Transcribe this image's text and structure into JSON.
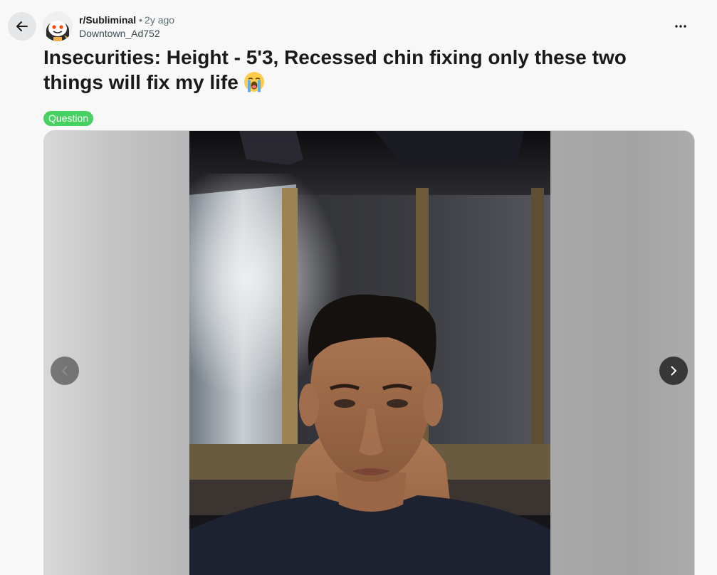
{
  "post": {
    "subreddit": "r/Subliminal",
    "separator": "•",
    "age": "2y ago",
    "author": "Downtown_Ad752",
    "title": "Insecurities: Height - 5'3, Recessed chin fixing only these two things will fix my life",
    "title_emoji": "loudly-crying-face-emoji",
    "flair": "Question",
    "flair_color": "#46d160"
  },
  "icons": {
    "back": "arrow-left-icon",
    "more": "more-horizontal-icon",
    "prev": "chevron-left-icon",
    "next": "chevron-right-icon"
  },
  "gallery": {
    "image": "selfie-photo",
    "has_prev": true,
    "has_next": true
  }
}
